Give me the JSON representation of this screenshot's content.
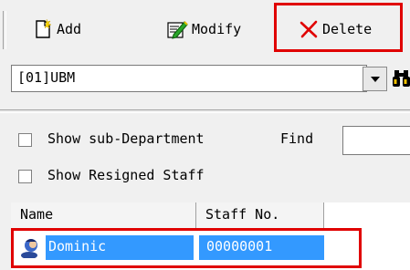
{
  "toolbar": {
    "add_label": "Add",
    "modify_label": "Modify",
    "delete_label": "Delete",
    "add_icon": "new-page-icon",
    "modify_icon": "edit-icon",
    "delete_icon": "x-cross-icon"
  },
  "department": {
    "selected": "[01]UBM",
    "search_icon": "binoculars-icon"
  },
  "options": {
    "show_sub_department_label": "Show sub-Department",
    "find_label": "Find",
    "find_value": "",
    "show_sub_department_checked": false,
    "show_resigned_label": "Show Resigned Staff",
    "show_resigned_checked": false
  },
  "table": {
    "columns": [
      "Name",
      "Staff No."
    ],
    "rows": [
      {
        "name": "Dominic",
        "staff_no": "00000001",
        "selected": true
      }
    ]
  },
  "colors": {
    "highlight_box": "#e00000",
    "selection": "#3399ff"
  }
}
